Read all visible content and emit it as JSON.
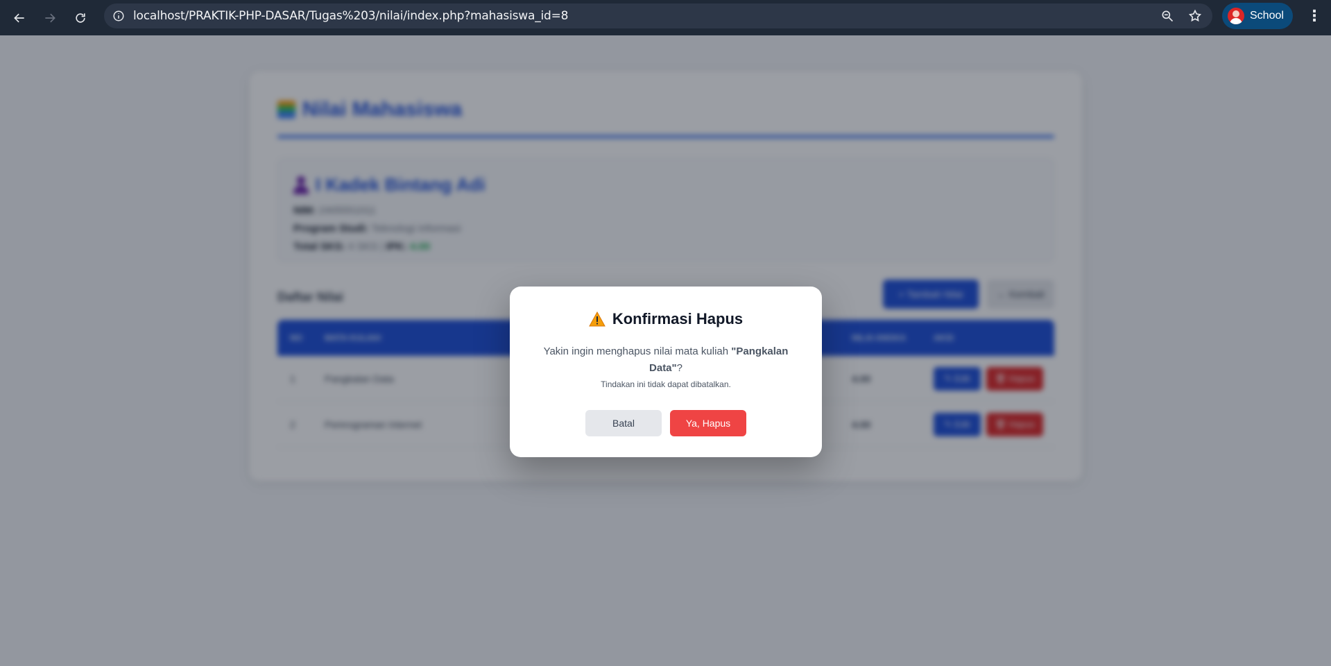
{
  "browser": {
    "url": "localhost/PRAKTIK-PHP-DASAR/Tugas%203/nilai/index.php?mahasiswa_id=8",
    "profile_name": "School"
  },
  "page": {
    "title": "Nilai Mahasiswa",
    "student": {
      "name": "I Kadek Bintang Adi",
      "nim_label": "NIM:",
      "nim": "2405551011",
      "prodi_label": "Program Studi:",
      "prodi": "Teknologi Informasi",
      "sks_label": "Total SKS:",
      "sks": "4 SKS",
      "separator": "|",
      "ipk_label": "IPK:",
      "ipk": "4.00"
    },
    "list_title": "Daftar Nilai",
    "add_button": "+ Tambah Nilai",
    "back_button": "← Kembali",
    "table": {
      "headers": {
        "no": "NO",
        "mata_kuliah": "MATA KULIAH",
        "nilai_angka": "NILAI ANGKA",
        "aksi": "AKSI"
      },
      "rows": [
        {
          "no": "1",
          "mata_kuliah": "Pangkalan Data",
          "nilai": "4.00",
          "edit": "✎ Edit",
          "hapus": "🗑 Hapus"
        },
        {
          "no": "2",
          "mata_kuliah": "Pemrograman Internet",
          "nilai": "4.00",
          "edit": "✎ Edit",
          "hapus": "🗑 Hapus"
        }
      ]
    }
  },
  "modal": {
    "title": "Konfirmasi Hapus",
    "message_prefix": "Yakin ingin menghapus nilai mata kuliah ",
    "course": "\"Pangkalan Data\"",
    "message_suffix": "?",
    "note": "Tindakan ini tidak dapat dibatalkan.",
    "cancel_label": "Batal",
    "confirm_label": "Ya, Hapus"
  },
  "colors": {
    "primary": "#1d4ed8",
    "danger": "#ef4444",
    "warning": "#f59e0b",
    "success": "#16a34a"
  },
  "icons": [
    "back-arrow-icon",
    "forward-arrow-icon",
    "reload-icon",
    "info-icon",
    "zoom-icon",
    "star-icon",
    "avatar",
    "menu-dots-icon",
    "chart-icon",
    "person-icon",
    "warning-icon"
  ]
}
